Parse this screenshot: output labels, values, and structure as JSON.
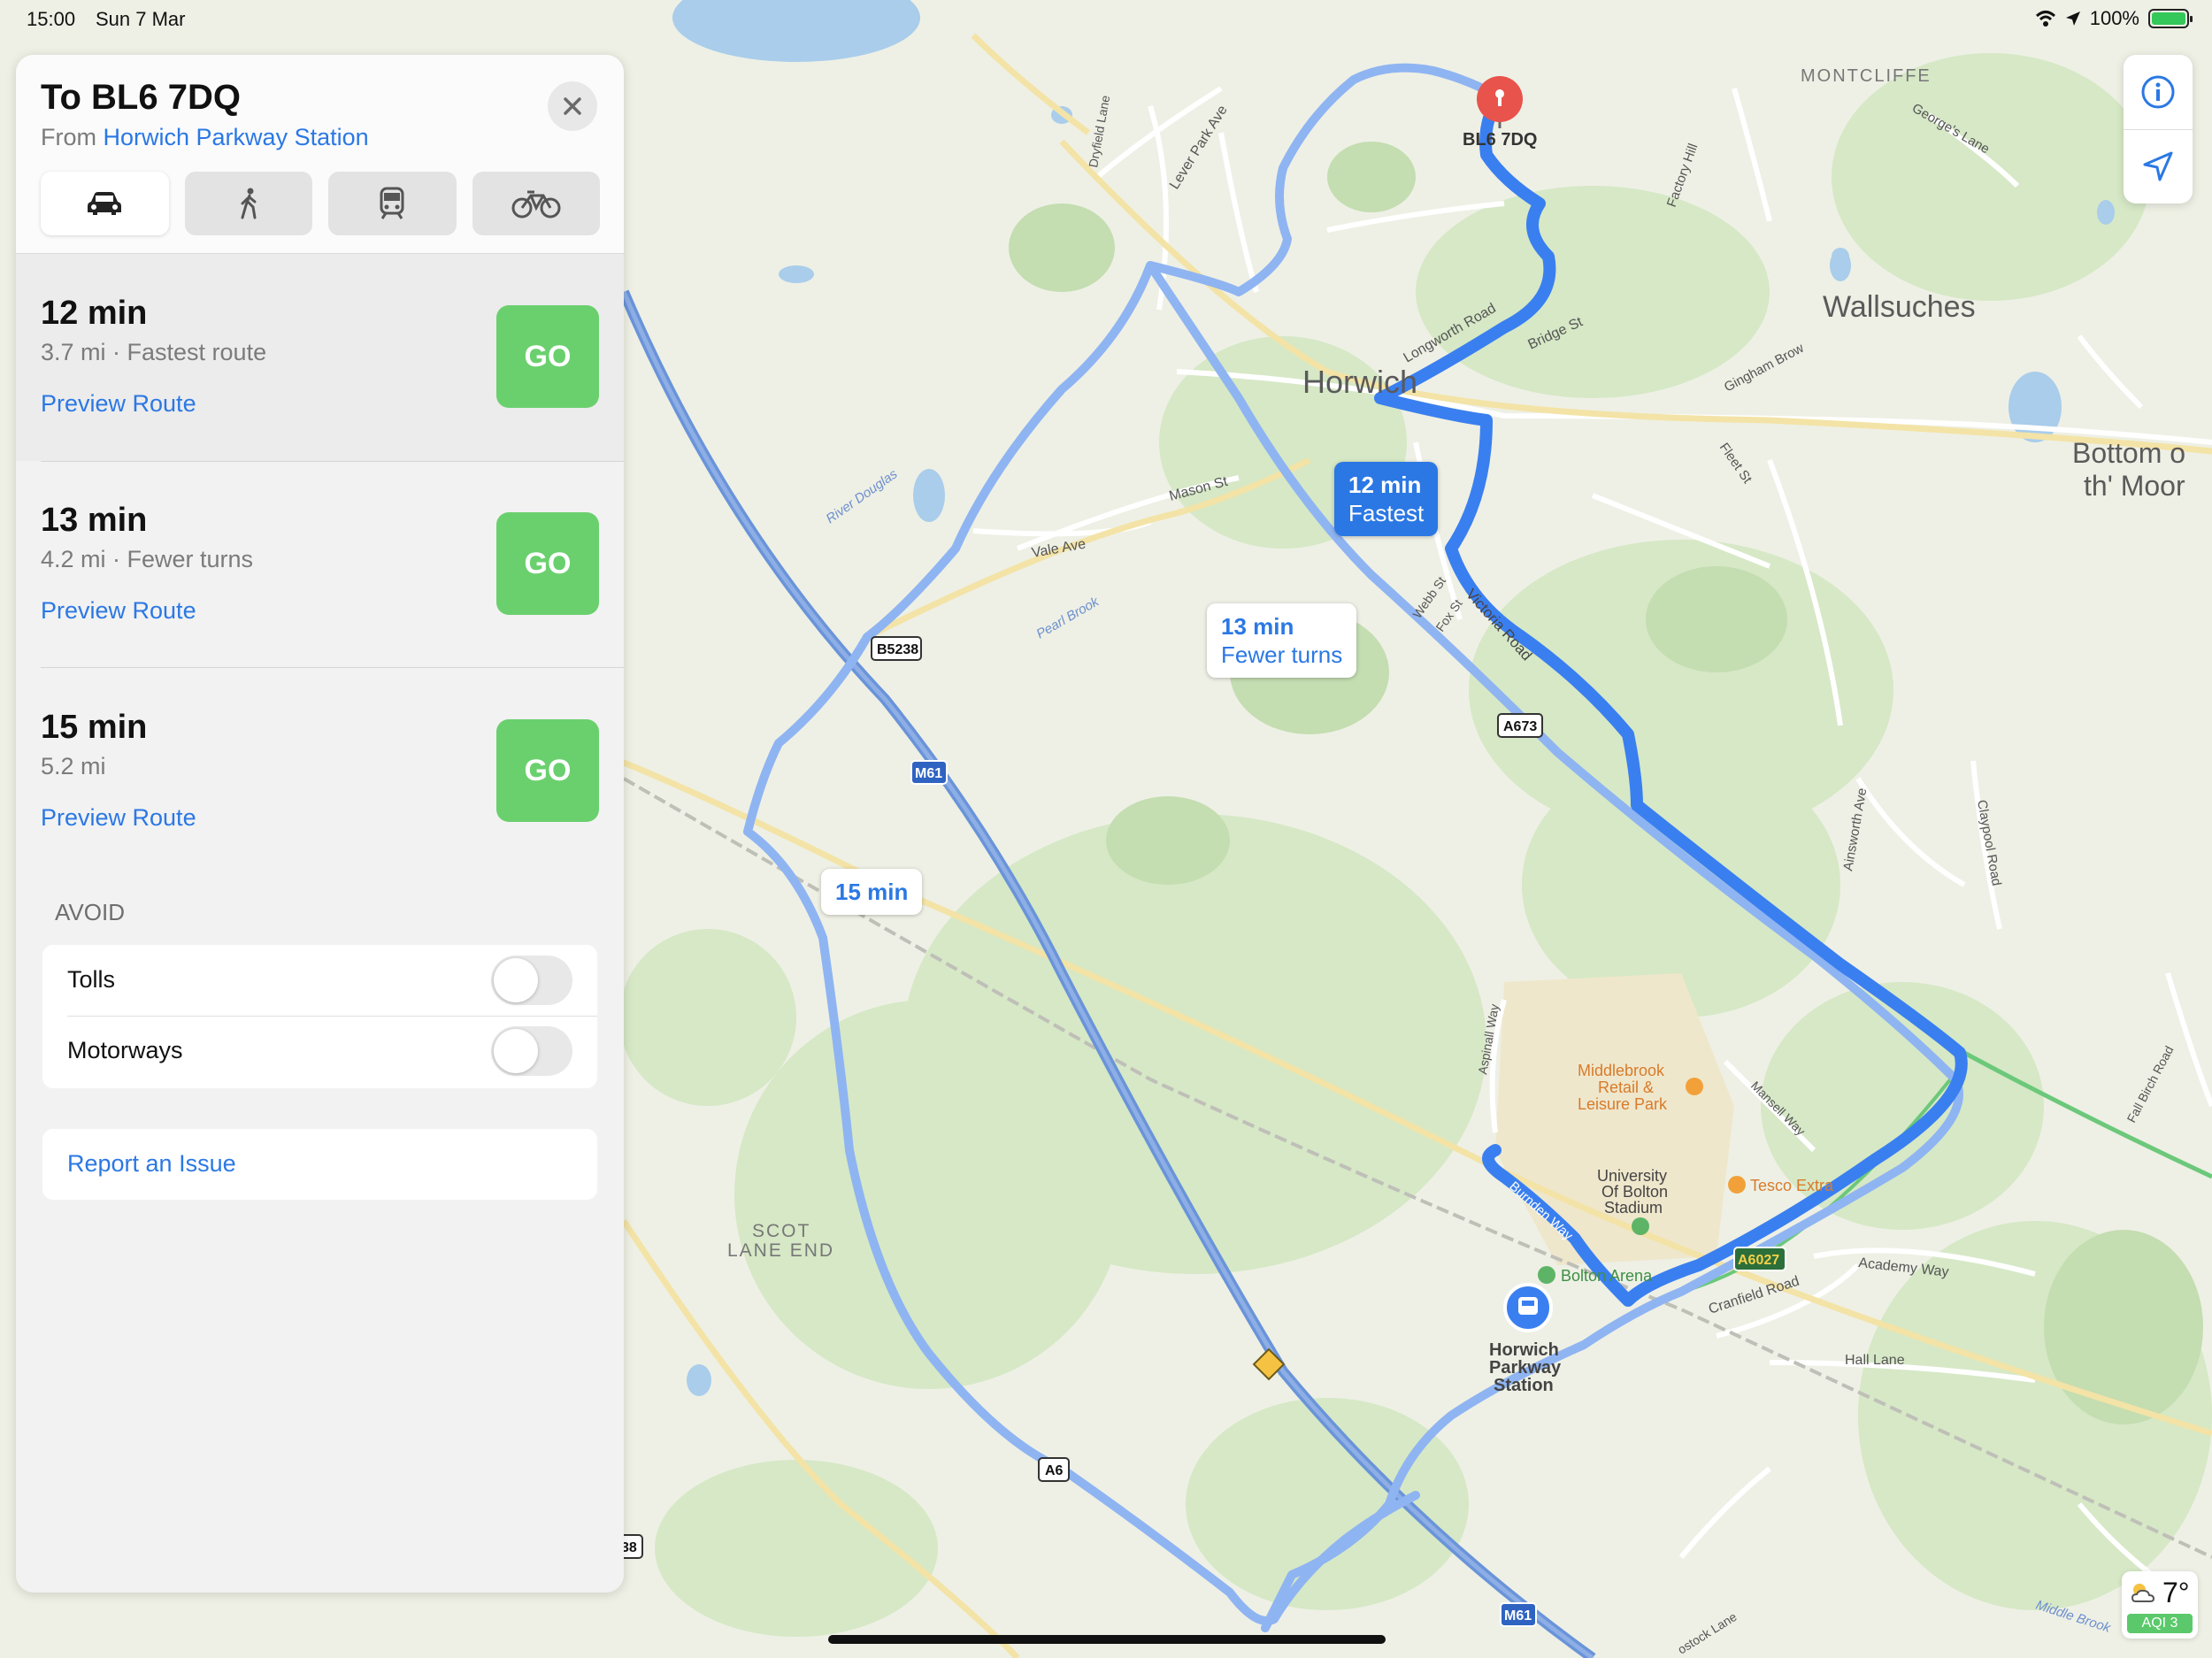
{
  "status": {
    "time": "15:00",
    "date": "Sun 7 Mar",
    "battery": "100%"
  },
  "directions": {
    "title": "To BL6 7DQ",
    "from_prefix": "From",
    "from_place": "Horwich Parkway Station",
    "modes": [
      "car-icon",
      "walk-icon",
      "transit-icon",
      "bike-icon"
    ],
    "routes": [
      {
        "time": "12 min",
        "sub": "3.7 mi · Fastest route",
        "preview": "Preview Route",
        "go": "GO"
      },
      {
        "time": "13 min",
        "sub": "4.2 mi · Fewer turns",
        "preview": "Preview Route",
        "go": "GO"
      },
      {
        "time": "15 min",
        "sub": "5.2 mi",
        "preview": "Preview Route",
        "go": "GO"
      }
    ],
    "avoid_title": "AVOID",
    "avoid": [
      {
        "label": "Tolls",
        "on": false
      },
      {
        "label": "Motorways",
        "on": false
      }
    ],
    "report": "Report an Issue"
  },
  "map": {
    "bubbles": [
      {
        "line1": "12 min",
        "line2": "Fastest"
      },
      {
        "line1": "13 min",
        "line2": "Fewer turns"
      },
      {
        "line1": "15 min"
      }
    ],
    "labels": {
      "destination": "BL6 7DQ",
      "horwich": "Horwich",
      "wallsuches": "Wallsuches",
      "montcliffe": "MONTCLIFFE",
      "bottom_line1": "Bottom o",
      "bottom_line2": "th' Moor",
      "scot_line1": "SCOT",
      "scot_line2": "LANE END",
      "station_line1": "Horwich",
      "station_line2": "Parkway",
      "station_line3": "Station",
      "middlebrook_line1": "Middlebrook",
      "middlebrook_line2": "Retail &",
      "middlebrook_line3": "Leisure Park",
      "uni_line1": "University",
      "uni_line2": "Of Bolton",
      "uni_line3": "Stadium",
      "tesco": "Tesco Extra",
      "bolton_arena": "Bolton Arena",
      "lever_park_ave": "Lever Park Ave",
      "longworth_road": "Longworth Road",
      "bridge_st": "Bridge St",
      "mason_st": "Mason St",
      "vale_ave": "Vale Ave",
      "pearl_brook": "Pearl Brook",
      "river_douglas": "River Douglas",
      "victoria_road": "Victoria Road",
      "webb_st": "Webb St",
      "fox_st": "Fox St",
      "burnden_way": "Burnden Way",
      "academy_way": "Academy Way",
      "hall_lane": "Hall Lane",
      "cranfield_road": "Cranfield Road",
      "middle_brook": "Middle Brook",
      "ainsworth_ave": "Ainsworth Ave",
      "claypool_road": "Claypool Road",
      "gingham_brow": "Gingham Brow",
      "fleet_st": "Fleet St",
      "georges_lane": "George's Lane",
      "factory_hill": "Factory Hill",
      "drytfield_lane": "Dryfield Lane",
      "aspinall_way": "Aspinall Way",
      "mansell_way": "Mansell Way",
      "fall_birch_road": "Fall Birch Road",
      "stock_lane": "ostock Lane"
    },
    "shields": {
      "b5238": "B5238",
      "m61": "M61",
      "a673": "A673",
      "a6027": "A6027",
      "a6": "A6",
      "m61b": "M61",
      "edge38": "38"
    }
  },
  "weather": {
    "temp": "7°",
    "aqi": "AQI 3"
  }
}
